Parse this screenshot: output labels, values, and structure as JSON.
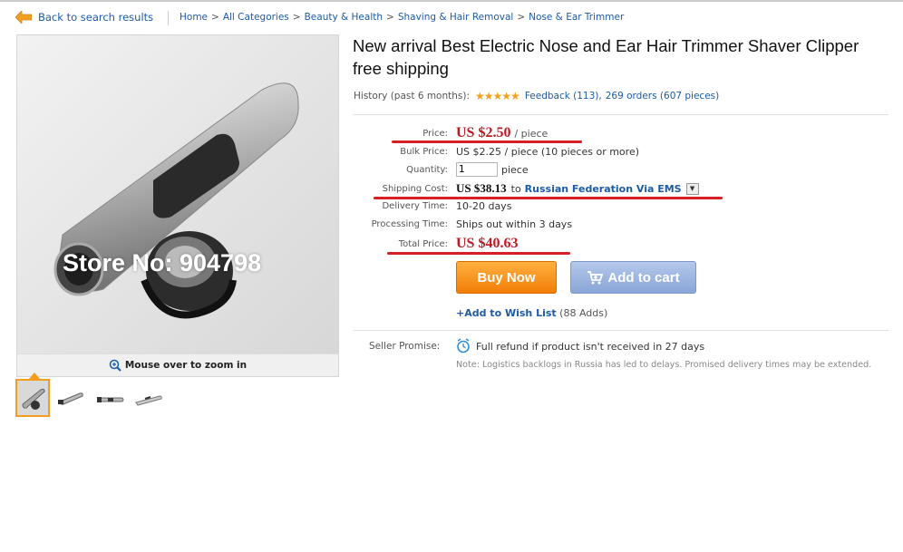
{
  "nav": {
    "back_label": "Back to search results",
    "breadcrumb": [
      "Home",
      "All Categories",
      "Beauty & Health",
      "Shaving & Hair Removal",
      "Nose & Ear Trimmer"
    ],
    "separator": ">"
  },
  "gallery": {
    "watermark": "Store No: 904798",
    "zoom_hint": "Mouse over to zoom in",
    "thumbnail_count": 4
  },
  "product": {
    "title": "New arrival Best Electric Nose and Ear Hair Trimmer Shaver Clipper free shipping",
    "history_label": "History (past 6 months):",
    "rating_stars": 5,
    "feedback_link": "Feedback (113),",
    "orders_text": "269 orders (607 pieces)"
  },
  "pricing": {
    "price_label": "Price:",
    "price_value": "US $2.50",
    "price_unit": "/ piece",
    "bulk_label": "Bulk Price:",
    "bulk_value": "US $2.25 / piece (10 pieces or more)",
    "quantity_label": "Quantity:",
    "quantity_value": "1",
    "quantity_unit": "piece",
    "shipping_label": "Shipping Cost:",
    "shipping_value": "US $38.13",
    "shipping_to": "to",
    "shipping_destination": "Russian Federation Via EMS",
    "delivery_label": "Delivery Time:",
    "delivery_value": "10-20 days",
    "processing_label": "Processing Time:",
    "processing_value": "Ships out within 3 days",
    "total_label": "Total Price:",
    "total_value": "US $40.63"
  },
  "actions": {
    "buy_now": "Buy Now",
    "add_to_cart": "Add to cart",
    "wish_list": "+Add to Wish List",
    "wish_count": "(88 Adds)"
  },
  "promise": {
    "label": "Seller Promise:",
    "refund": "Full refund if product isn't received in 27 days",
    "note": "Note: Logistics backlogs in Russia has led to delays. Promised delivery times may be extended."
  },
  "colors": {
    "link": "#1d5ba7",
    "price_red": "#b81c22",
    "buy_orange": "#f27e07",
    "cart_blue": "#8aa6d7",
    "highlight_red": "#d81f26"
  }
}
